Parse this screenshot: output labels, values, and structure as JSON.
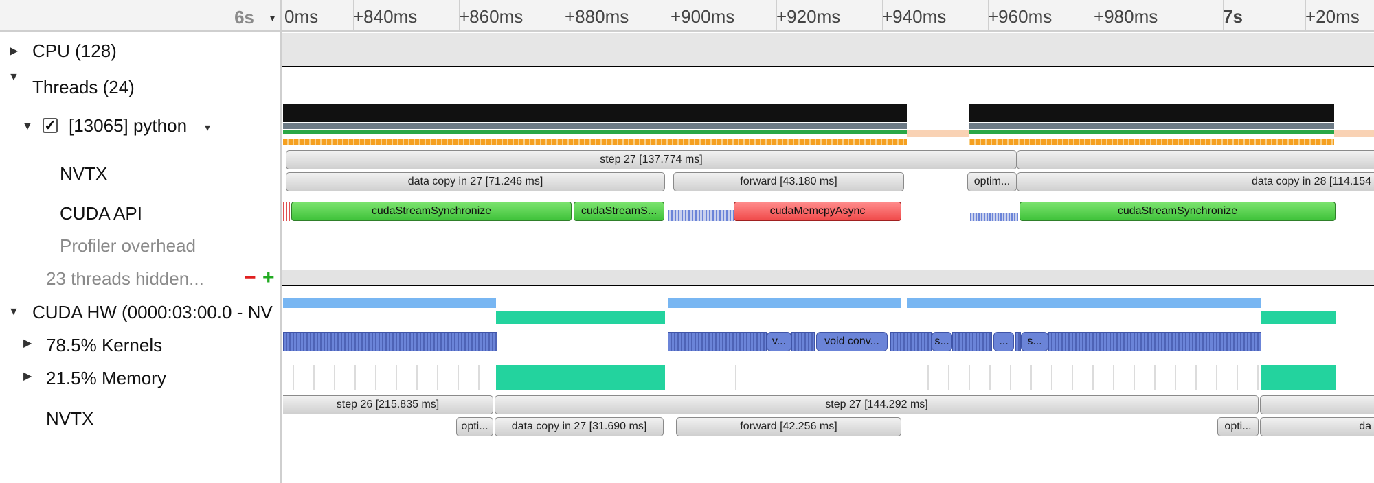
{
  "header": {
    "zoom_label": "6s",
    "zoom_caret": "▾"
  },
  "ruler": {
    "ticks": [
      {
        "label": "0ms",
        "bold": false
      },
      {
        "label": "+840ms",
        "bold": false
      },
      {
        "label": "+860ms",
        "bold": false
      },
      {
        "label": "+880ms",
        "bold": false
      },
      {
        "label": "+900ms",
        "bold": false
      },
      {
        "label": "+920ms",
        "bold": false
      },
      {
        "label": "+940ms",
        "bold": false
      },
      {
        "label": "+960ms",
        "bold": false
      },
      {
        "label": "+980ms",
        "bold": false
      },
      {
        "label": "7s",
        "bold": true
      },
      {
        "label": "+20ms",
        "bold": false
      }
    ]
  },
  "tree": {
    "cpu": "CPU (128)",
    "threads": "Threads (24)",
    "process": "[13065] python",
    "nvtx": "NVTX",
    "cuda_api": "CUDA API",
    "profiler_overhead": "Profiler overhead",
    "hidden": "23 threads hidden...",
    "minus": "−",
    "plus": "+",
    "cuda_hw": "CUDA HW (0000:03:00.0 - NV",
    "kernels": "78.5% Kernels",
    "memory": "21.5% Memory",
    "hw_nvtx": "NVTX",
    "checkbox": "✓",
    "expand_icon": "▶",
    "collapse_icon": "▼",
    "caret_icon": "▾"
  },
  "timeline": {
    "nvtx_top": {
      "step": "step 27 [137.774 ms]",
      "data_copy": "data copy in 27 [71.246 ms]",
      "forward": "forward [43.180 ms]",
      "optim": "optim...",
      "data_copy_next": "data copy in 28 [114.154"
    },
    "cuda_api": {
      "sync1": "cudaStreamSynchronize",
      "sync2": "cudaStreamS...",
      "memcpy": "cudaMemcpyAsync",
      "sync3": "cudaStreamSynchronize"
    },
    "kernels": {
      "k1": "v...",
      "k2": "void conv...",
      "k3": "s...",
      "k4": "...",
      "k5": "s..."
    },
    "nvtx_hw": {
      "step26": "step 26 [215.835 ms]",
      "step27": "step 27 [144.292 ms]",
      "opti1": "opti...",
      "data_copy": "data copy in 27 [31.690 ms]",
      "forward": "forward [42.256 ms]",
      "opti2": "opti...",
      "da": "da"
    }
  },
  "colors": {
    "api_green": "#4cc945",
    "api_red": "#f04a4a",
    "kernel_blue": "#6b84d8",
    "memory_teal": "#23d39e",
    "hw_blue": "#78b6f2"
  }
}
